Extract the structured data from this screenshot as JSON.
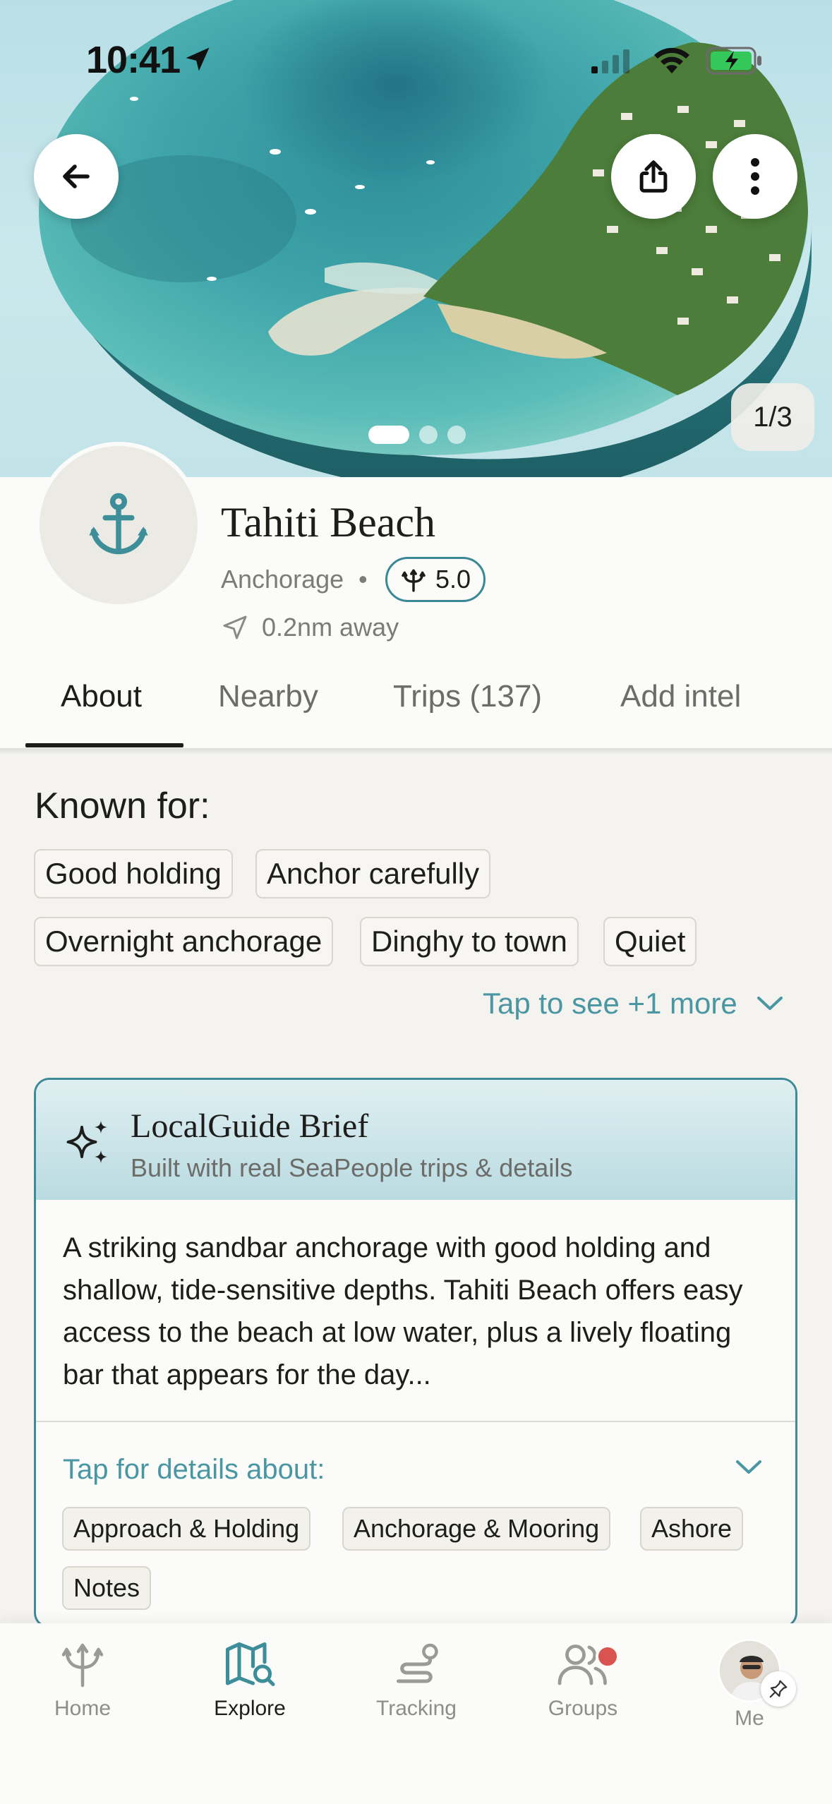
{
  "status_bar": {
    "time": "10:41",
    "icons": [
      "location-arrow-icon",
      "cellular-signal-icon",
      "wifi-icon",
      "battery-charging-icon"
    ]
  },
  "hero": {
    "image_counter": "1/3",
    "pages_total": 3,
    "active_page": 1,
    "icons": {
      "back": "arrow-left-icon",
      "share": "share-icon",
      "more": "more-vertical-icon"
    }
  },
  "place": {
    "name": "Tahiti Beach",
    "type": "Anchorage",
    "separator": "•",
    "rating": "5.0",
    "distance": "0.2nm away",
    "icon": "anchor-icon"
  },
  "tabs": [
    {
      "label": "About",
      "active": true
    },
    {
      "label": "Nearby",
      "active": false
    },
    {
      "label": "Trips (137)",
      "active": false
    },
    {
      "label": "Add intel",
      "active": false
    }
  ],
  "known_for": {
    "title": "Known for:",
    "chips": [
      "Good holding",
      "Anchor carefully",
      "Overnight anchorage",
      "Dinghy to town",
      "Quiet"
    ],
    "see_more": "Tap to see +1 more"
  },
  "brief": {
    "title": "LocalGuide Brief",
    "subtitle": "Built with real SeaPeople trips & details",
    "body": "A striking sandbar anchorage with good holding and shallow, tide-sensitive depths. Tahiti Beach offers easy access to the beach at low water, plus a lively floating bar that appears for the day...",
    "details_label": "Tap for details about:",
    "detail_chips": [
      "Approach & Holding",
      "Anchorage & Mooring",
      "Ashore",
      "Notes"
    ]
  },
  "bottom_nav": [
    {
      "label": "Home",
      "icon": "trident-icon",
      "active": false
    },
    {
      "label": "Explore",
      "icon": "map-search-icon",
      "active": true
    },
    {
      "label": "Tracking",
      "icon": "route-icon",
      "active": false
    },
    {
      "label": "Groups",
      "icon": "users-icon",
      "active": false,
      "badge": true
    },
    {
      "label": "Me",
      "icon": "avatar",
      "active": false
    }
  ],
  "colors": {
    "accent": "#4a96a2",
    "accent_border": "#3f8a97",
    "background": "#f4f3ef",
    "badge": "#d9534f"
  }
}
